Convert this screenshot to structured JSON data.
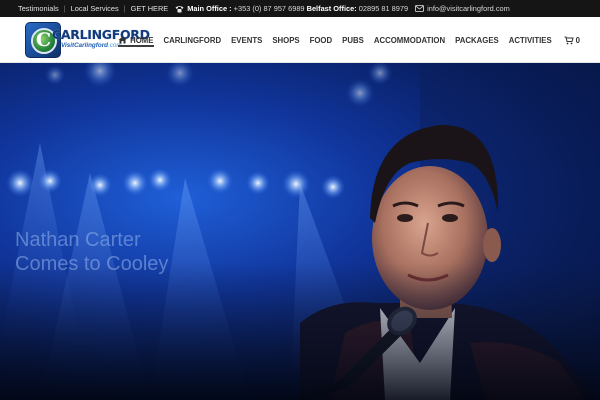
{
  "topbar": {
    "links": [
      "Testimonials",
      "Local Services",
      "GET HERE"
    ],
    "main_office_label": "Main Office :",
    "main_office_phone": "+353 (0) 87 957 6989",
    "belfast_office_label": "Belfast Office:",
    "belfast_office_phone": "02895 81 8979",
    "email": "info@visitcarlingford.com"
  },
  "logo": {
    "brand": "CARLINGFORD",
    "url_main": "VisitCarlingford",
    "url_suffix": ".com"
  },
  "nav": {
    "items": [
      "HOME",
      "CARLINGFORD",
      "EVENTS",
      "SHOPS",
      "FOOD",
      "PUBS",
      "ACCOMMODATION",
      "PACKAGES",
      "ACTIVITIES"
    ],
    "active": "HOME",
    "cart_count": "0"
  },
  "hero": {
    "title_line1": "Nathan Carter",
    "title_line2": "Comes to Cooley"
  },
  "colors": {
    "topbar_bg": "#151515",
    "header_bg": "#ffffff",
    "hero_blue": "#1f5fd8"
  },
  "icons": [
    "phone-icon",
    "mail-icon",
    "home-icon",
    "cart-icon"
  ]
}
